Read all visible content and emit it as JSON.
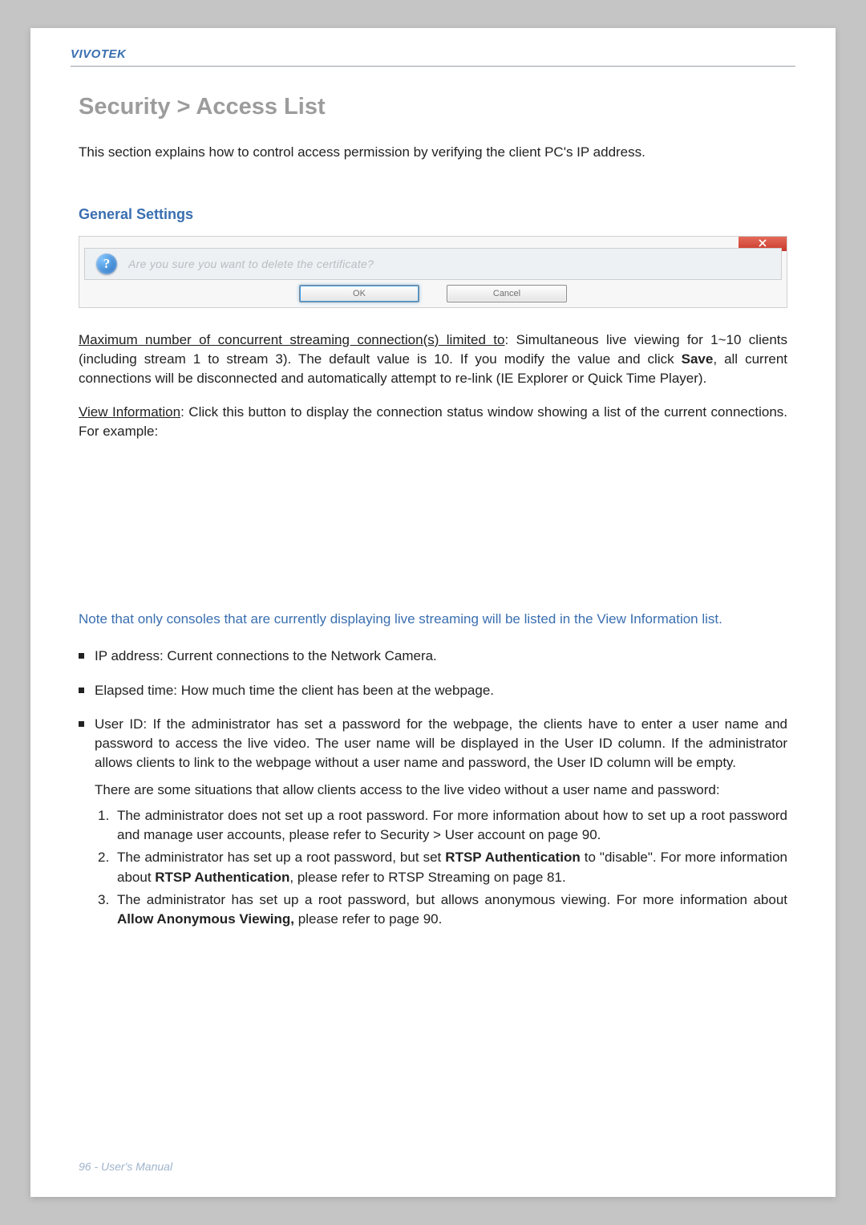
{
  "brand": "VIVOTEK",
  "breadcrumb": "Security >  Access List",
  "intro": "This section explains how to control access permission by verifying the client PC's IP address.",
  "section_general": "General Settings",
  "dialog": {
    "message": "Are you sure you want to delete the certificate?",
    "ok": "OK",
    "cancel": "Cancel"
  },
  "para_max_prefix": "Maximum number of concurrent streaming connection(s) limited to",
  "para_max_rest": ": Simultaneous live viewing for 1~10 clients (including stream 1 to stream 3). The default value is 10. If you modify the value and click ",
  "para_max_save": "Save",
  "para_max_tail": ", all current connections will be disconnected and automatically attempt to re-link (IE Explorer or Quick Time Player).",
  "para_view_prefix": "View Information",
  "para_view_rest": ": Click this button to display the connection status window showing a list of the current connections. For example:",
  "note_text": "Note that only consoles that are currently displaying live streaming will be listed in the View Information list.",
  "bullets": {
    "ip": "IP address: Current connections to the Network Camera.",
    "elapsed": "Elapsed time: How much time the client has been at the webpage.",
    "userid_main": "User ID: If the administrator has set a password for the webpage, the clients have to enter a user name and password to access the live video. The user name will be displayed in the User ID column. If  the administrator allows clients to link to the webpage without a user name and password, the User ID column will be empty."
  },
  "userid_sub": "There are some situations that allow clients access to the live video without a user name and password:",
  "numlist": {
    "n1": "The administrator does not set up a root password. For more information about how to set up a root password and manage user accounts, please refer to Security > User account on page 90.",
    "n2_a": "The administrator has set up a root password, but set ",
    "n2_b": "RTSP Authentication",
    "n2_c": " to \"disable\". For more information about ",
    "n2_d": "RTSP Authentication",
    "n2_e": ", please refer to RTSP Streaming on page 81.",
    "n3_a": "The administrator has set up a root password, but allows anonymous viewing. For more information about ",
    "n3_b": "Allow Anonymous Viewing,",
    "n3_c": " please refer to page 90."
  },
  "footer": "96 - User's Manual"
}
